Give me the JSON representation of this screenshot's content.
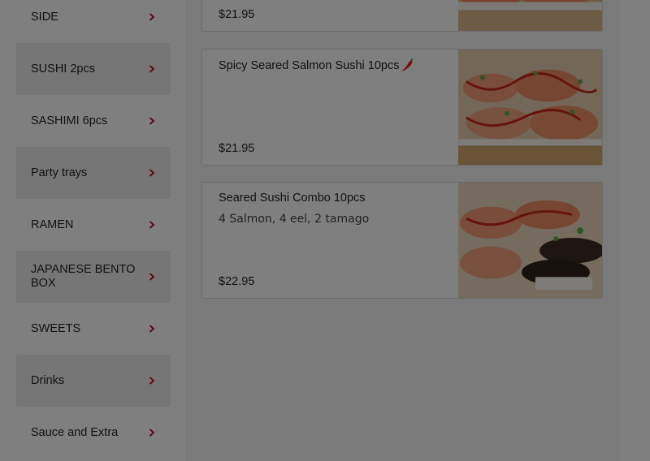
{
  "categories": [
    {
      "label": "SIDE"
    },
    {
      "label": "SUSHI 2pcs"
    },
    {
      "label": "SASHIMI 6pcs"
    },
    {
      "label": "Party trays"
    },
    {
      "label": "RAMEN"
    },
    {
      "label": "JAPANESE BENTO BOX"
    },
    {
      "label": "SWEETS"
    },
    {
      "label": "Drinks"
    },
    {
      "label": "Sauce and Extra"
    }
  ],
  "items": [
    {
      "name": "",
      "description": "",
      "price": "$21.95",
      "icon": "sushi-photo"
    },
    {
      "name": "Spicy Seared Salmon Sushi 10pcs",
      "description": "",
      "price": "$21.95",
      "badge_icon": "chili-pepper-icon"
    },
    {
      "name": "Seared Sushi Combo 10pcs",
      "description": "4 Salmon, 4 eel, 2 tamago",
      "price": "$22.95"
    }
  ],
  "colors": {
    "accent": "#c8102e",
    "alt_row": "#ececec",
    "overlay": "rgba(0,0,0,0.5)"
  }
}
